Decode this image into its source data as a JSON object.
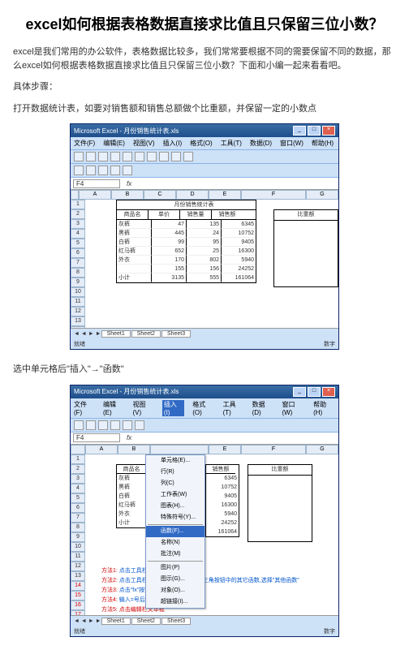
{
  "article": {
    "title": "excel如何根据表格数据直接求比值且只保留三位小数？",
    "intro": "excel是我们常用的办公软件，表格数据比较多，我们常常要根据不同的需要保留不同的数据，那么excel如何根据表格数据直接求比值且只保留三位小数？下面和小编一起来看看吧。",
    "steps_label": "具体步骤：",
    "step1": "打开数据统计表，如要对销售额和销售总额做个比重额，并保留一定的小数点",
    "step2": "选中单元格后\"插入\"→\"函数\""
  },
  "excel": {
    "title": "Microsoft Excel - 月份销售统计表.xls",
    "menus": [
      "文件(F)",
      "编辑(E)",
      "视图(V)",
      "插入(I)",
      "格式(O)",
      "工具(T)",
      "数据(D)",
      "窗口(W)",
      "帮助(H)"
    ],
    "name_box": "F4",
    "fx_label": "fx",
    "cols": [
      "A",
      "B",
      "C",
      "D",
      "E",
      "F",
      "G"
    ],
    "row_nums": [
      "1",
      "2",
      "3",
      "4",
      "5",
      "6",
      "7",
      "8",
      "9",
      "10",
      "11",
      "12",
      "13",
      "14",
      "15",
      "16",
      "17"
    ],
    "block_title": "月份销售统计表",
    "headers": {
      "name": "商品名",
      "price": "单价",
      "qty": "销售量",
      "amount": "销售额"
    },
    "ratio_header": "比重额",
    "rows": [
      {
        "name": "灰裤",
        "price": "47",
        "qty": "135",
        "amount": "6345"
      },
      {
        "name": "黑裤",
        "price": "445",
        "qty": "24",
        "amount": "10752"
      },
      {
        "name": "白裤",
        "price": "99",
        "qty": "95",
        "amount": "9405"
      },
      {
        "name": "红马裤",
        "price": "652",
        "qty": "25",
        "amount": "16300"
      },
      {
        "name": "外衣",
        "price": "170",
        "qty": "802",
        "amount": "5940"
      },
      {
        "name": "",
        "price": "155",
        "qty": "156",
        "amount": "24252"
      },
      {
        "name": "小计",
        "price": "3135",
        "qty": "555",
        "amount": "161064"
      }
    ],
    "sheets": [
      "Sheet1",
      "Sheet2",
      "Sheet3"
    ],
    "status_left": "就绪",
    "status_right": "数字"
  },
  "insert_menu": {
    "items": [
      "单元格(E)...",
      "行(R)",
      "列(C)",
      "工作表(W)",
      "图表(H)...",
      "特殊符号(Y)...",
      "函数(F)...",
      "名称(N)",
      "批注(M)",
      "图片(P)",
      "图示(G)...",
      "对象(O)...",
      "超链接(I)..."
    ]
  },
  "shot2_data": {
    "rows": [
      {
        "name": "灰裤",
        "amount": "6345"
      },
      {
        "name": "黑裤",
        "amount": "10752"
      },
      {
        "name": "白裤",
        "amount": "9405"
      },
      {
        "name": "红马裤",
        "amount": "16300"
      },
      {
        "name": "外衣",
        "amount": "5940"
      },
      {
        "name": "",
        "amount": "24252"
      },
      {
        "name": "小计",
        "amount": "161064"
      }
    ]
  },
  "tips": [
    {
      "lbl": "方法1:",
      "rest": "点击工具栏\"插入\"→\"函数\""
    },
    {
      "lbl": "方法2:",
      "rest": "点击工具栏上的\"自动求和\"边的倒三角按钮中的其它函数,选择\"其他函数\""
    },
    {
      "lbl": "方法3:",
      "rest": "点击\"fx\"按钮"
    },
    {
      "lbl": "方法4:",
      "rest": "输入=号后选择函数"
    },
    {
      "lbl": "方法5:",
      "rest": "点击编辑栏文本框"
    }
  ]
}
